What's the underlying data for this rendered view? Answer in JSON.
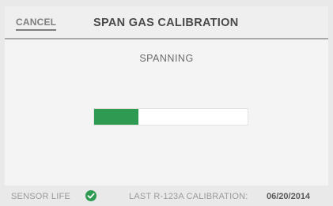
{
  "header": {
    "cancel_label": "CANCEL",
    "title": "SPAN GAS CALIBRATION"
  },
  "main": {
    "status": "SPANNING",
    "progress_fraction": 0.29
  },
  "footer": {
    "sensor_life_label": "SENSOR LIFE",
    "sensor_icon": "check-circle-icon",
    "calibration_label": "LAST R-123A CALIBRATION:",
    "calibration_date": "06/20/2014"
  },
  "colors": {
    "accent": "#2f9a52"
  }
}
